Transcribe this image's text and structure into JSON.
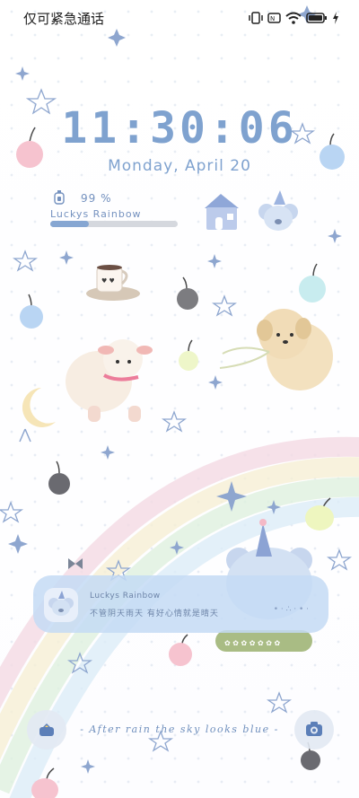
{
  "status_bar": {
    "carrier": "仅可紧急通话",
    "icons": [
      "vibrate-icon",
      "nfc-icon",
      "wifi-icon",
      "battery-icon",
      "charging-icon"
    ]
  },
  "lock": {
    "time": "11:30:06",
    "date": "Monday, April  20"
  },
  "battery_widget": {
    "percent_label": "99 %",
    "percent": 99,
    "name": "Luckys Rainbow"
  },
  "notification": {
    "title": "Luckys Rainbow",
    "text": "不管阴天雨天 有好心情就是晴天"
  },
  "tagline": "- After rain the sky looks blue -",
  "shortcuts": {
    "left": "lock-screen-theme-icon",
    "right": "camera-icon"
  },
  "colors": {
    "accent": "#7fa2cf",
    "notification_bg": "#c4daf4",
    "battery_fill": "#86a6d2"
  }
}
